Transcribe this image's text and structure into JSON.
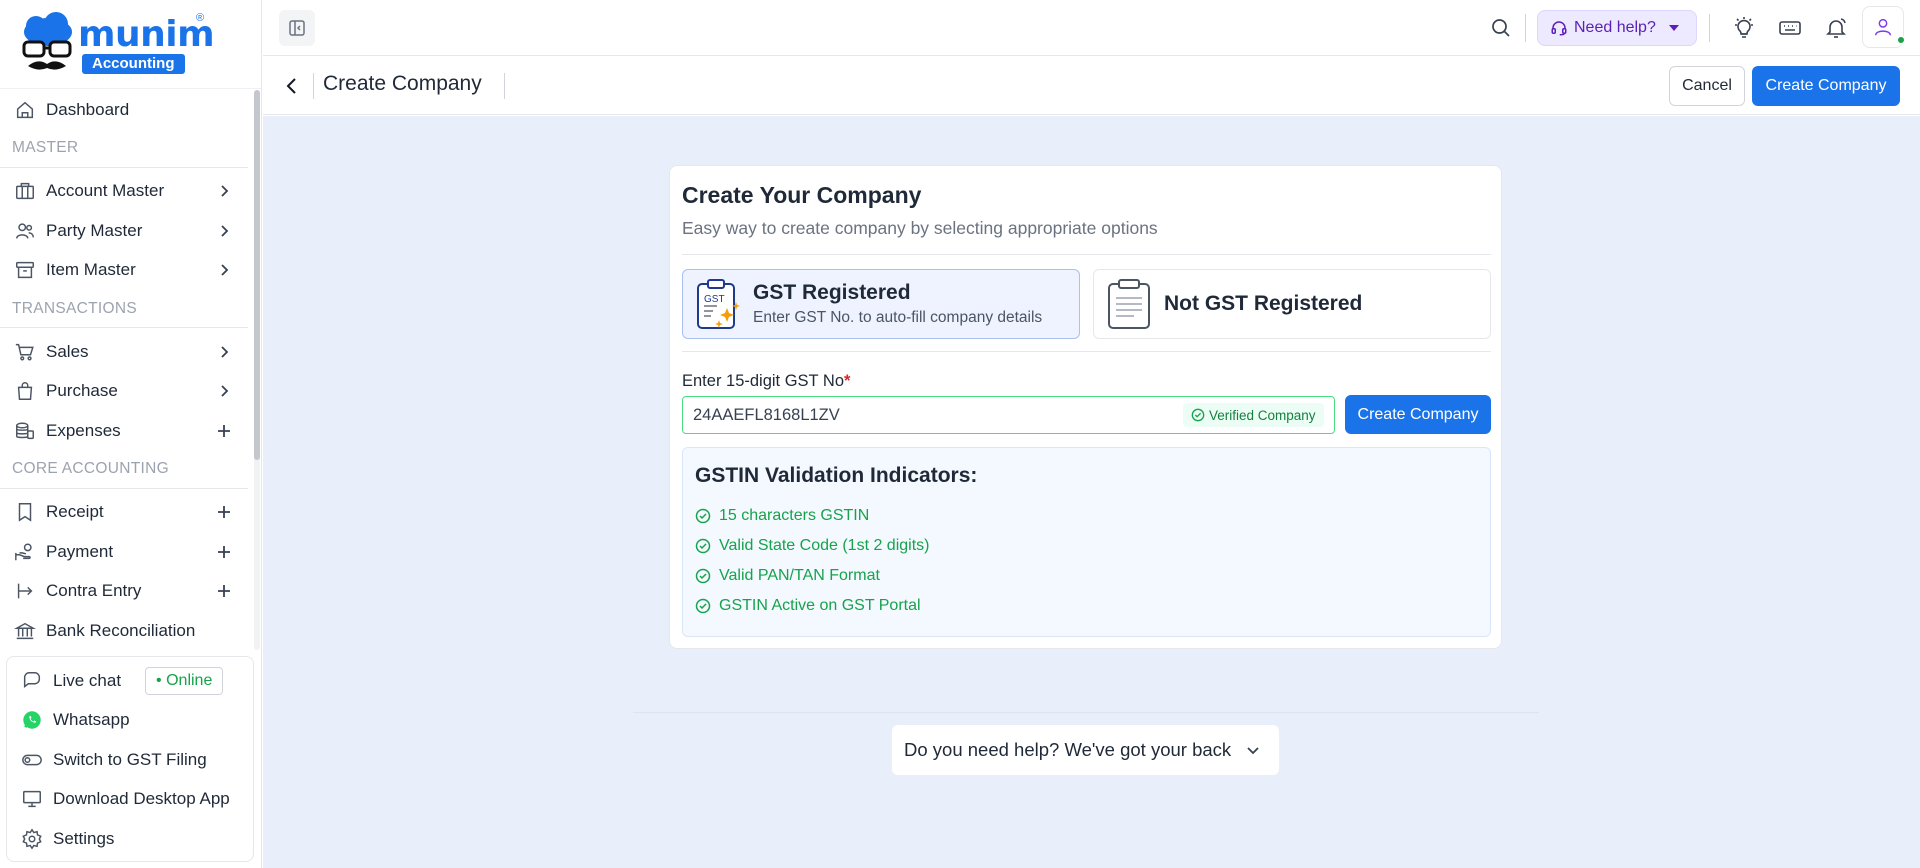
{
  "brand": {
    "name": "munim",
    "registered": "®",
    "badge": "Accounting"
  },
  "sidebar": {
    "items": [
      {
        "label": "Dashboard"
      },
      {
        "section": "MASTER"
      },
      {
        "label": "Account Master"
      },
      {
        "label": "Party Master"
      },
      {
        "label": "Item Master"
      },
      {
        "section": "TRANSACTIONS"
      },
      {
        "label": "Sales"
      },
      {
        "label": "Purchase"
      },
      {
        "label": "Expenses"
      },
      {
        "section": "CORE ACCOUNTING"
      },
      {
        "label": "Receipt"
      },
      {
        "label": "Payment"
      },
      {
        "label": "Contra Entry"
      },
      {
        "label": "Bank Reconciliation"
      }
    ],
    "bottom": {
      "live_chat": "Live chat",
      "online": "• Online",
      "whatsapp": "Whatsapp",
      "switch_gst": "Switch to GST Filing",
      "download": "Download Desktop App",
      "settings": "Settings"
    }
  },
  "topbar": {
    "need_help": "Need help?"
  },
  "header": {
    "title": "Create Company",
    "cancel": "Cancel",
    "create": "Create Company"
  },
  "card": {
    "title": "Create Your Company",
    "subtitle": "Easy way to create company by selecting appropriate options",
    "option_gst": {
      "title": "GST Registered",
      "desc": "Enter GST No. to auto-fill company details",
      "icon_text": "GST"
    },
    "option_non_gst": {
      "title": "Not GST Registered"
    },
    "field_label": "Enter 15-digit GST No",
    "required_mark": "*",
    "gst_value": "24AAEFL8168L1ZV",
    "verified": "Verified Company",
    "create_button": "Create Company",
    "validation": {
      "title": "GSTIN Validation Indicators:",
      "items": [
        "15 characters GSTIN",
        "Valid State Code (1st 2 digits)",
        "Valid PAN/TAN Format",
        "GSTIN Active on GST Portal"
      ]
    }
  },
  "help_footer": "Do you need help? We've got your back",
  "colors": {
    "accent": "#1a73e8",
    "success": "#16a34a",
    "background": "#e9eefb"
  }
}
